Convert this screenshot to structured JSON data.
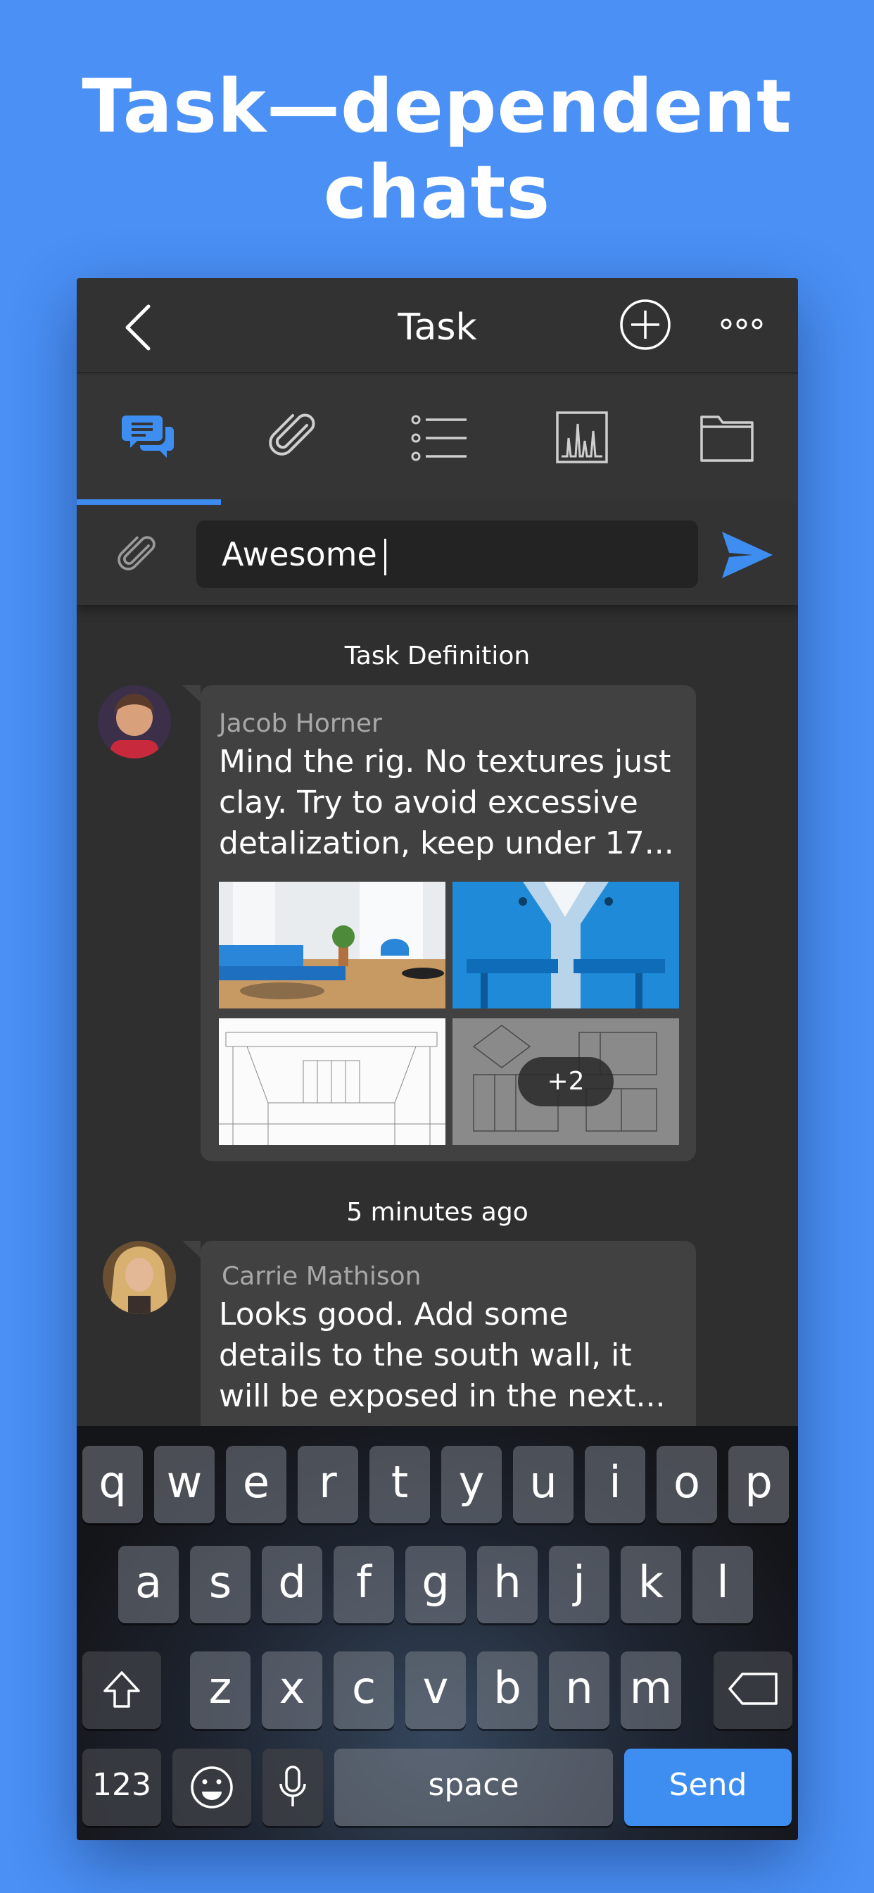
{
  "headline": {
    "line1": "Task—dependent",
    "line2": "chats"
  },
  "navbar": {
    "title": "Task"
  },
  "tabs": [
    {
      "icon": "chat-bubbles-icon",
      "active": true
    },
    {
      "icon": "paperclip-icon",
      "active": false
    },
    {
      "icon": "list-icon",
      "active": false
    },
    {
      "icon": "chart-icon",
      "active": false
    },
    {
      "icon": "folder-icon",
      "active": false
    }
  ],
  "composer": {
    "value": "Awesome"
  },
  "chat": {
    "section_label": "Task Definition",
    "messages": [
      {
        "author": "Jacob Horner",
        "lines": [
          "Mind the rig. No textures just",
          "clay. Try to avoid excessive",
          "detalization, keep under 17..."
        ],
        "more_images": "+2"
      },
      {
        "time_label": "5 minutes ago",
        "author": "Carrie Mathison",
        "lines": [
          "Looks good. Add some",
          "details to the south wall, it",
          "will be exposed in the next..."
        ]
      }
    ]
  },
  "keyboard": {
    "row1": [
      "q",
      "w",
      "e",
      "r",
      "t",
      "y",
      "u",
      "i",
      "o",
      "p"
    ],
    "row2": [
      "a",
      "s",
      "d",
      "f",
      "g",
      "h",
      "j",
      "k",
      "l"
    ],
    "row3": [
      "z",
      "x",
      "c",
      "v",
      "b",
      "n",
      "m"
    ],
    "numbers": "123",
    "space": "space",
    "send": "Send"
  },
  "colors": {
    "background": "#4a90f5",
    "accent": "#3e8ef2",
    "panel": "#2f2f2f"
  }
}
